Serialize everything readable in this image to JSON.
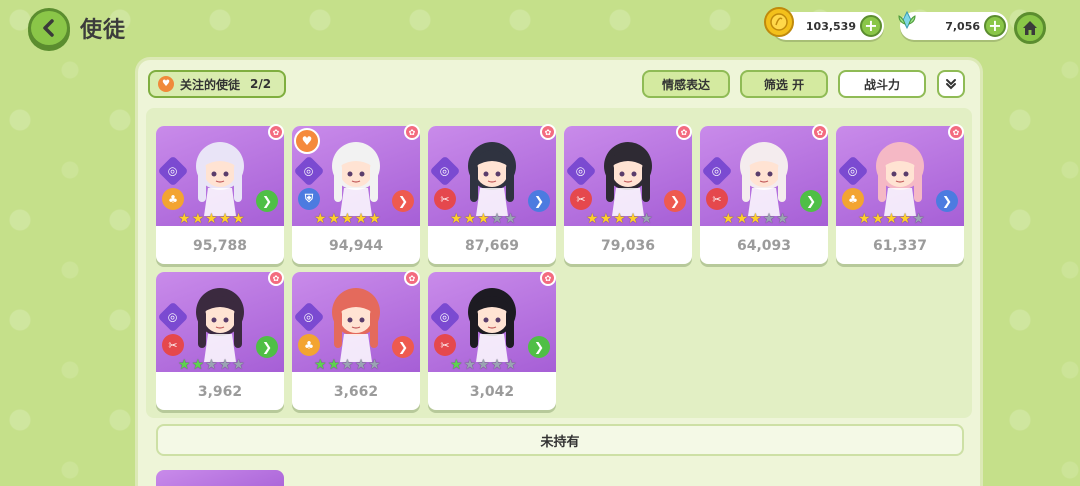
{
  "header": {
    "title": "使徒",
    "coin_value": "103,539",
    "gem_value": "7,056",
    "plus": "+"
  },
  "toolbar": {
    "follow_label": "关注的使徒",
    "follow_count": "2/2",
    "emote_label": "情感表达",
    "filter_label": "筛选 开",
    "power_label": "战斗力",
    "collapse_icon": "double-chevron-down"
  },
  "cards": [
    {
      "power": "95,788",
      "stars": 5,
      "star_color": "gold",
      "fav": false,
      "role": "♣",
      "role_color": "#f3a431",
      "arrow_color": "#4fbf46",
      "hair": "#e9e4f7"
    },
    {
      "power": "94,944",
      "stars": 5,
      "star_color": "gold",
      "fav": true,
      "role": "⛨",
      "role_color": "#4c7be0",
      "arrow_color": "#ee5a4f",
      "hair": "#f2f2f2"
    },
    {
      "power": "87,669",
      "stars": 3,
      "star_color": "gold",
      "fav": false,
      "role": "✂",
      "role_color": "#e5484d",
      "arrow_color": "#4c7be0",
      "hair": "#2f3340"
    },
    {
      "power": "79,036",
      "stars": 4,
      "star_color": "gold",
      "fav": false,
      "role": "✂",
      "role_color": "#e5484d",
      "arrow_color": "#ee5a4f",
      "hair": "#2e2a33"
    },
    {
      "power": "64,093",
      "stars": 3,
      "star_color": "gold",
      "fav": false,
      "role": "✂",
      "role_color": "#e5484d",
      "arrow_color": "#4fbf46",
      "hair": "#f4ecee"
    },
    {
      "power": "61,337",
      "stars": 4,
      "star_color": "gold",
      "fav": false,
      "role": "♣",
      "role_color": "#f3a431",
      "arrow_color": "#4c7be0",
      "hair": "#f5b8c5"
    },
    {
      "power": "3,962",
      "stars": 2,
      "star_color": "green",
      "fav": false,
      "role": "✂",
      "role_color": "#e5484d",
      "arrow_color": "#4fbf46",
      "hair": "#3b2a3f"
    },
    {
      "power": "3,662",
      "stars": 2,
      "star_color": "green",
      "fav": false,
      "role": "♣",
      "role_color": "#f3a431",
      "arrow_color": "#ee5a4f",
      "hair": "#e46a5c"
    },
    {
      "power": "3,042",
      "stars": 1,
      "star_color": "green",
      "fav": false,
      "role": "✂",
      "role_color": "#e5484d",
      "arrow_color": "#4fbf46",
      "hair": "#1d1b22"
    }
  ],
  "unowned_label": "未持有",
  "colors": {
    "bg": "#c5e08a",
    "panel": "#eef5d8",
    "card_art": "#b574e0",
    "accent_green": "#8ac648"
  }
}
